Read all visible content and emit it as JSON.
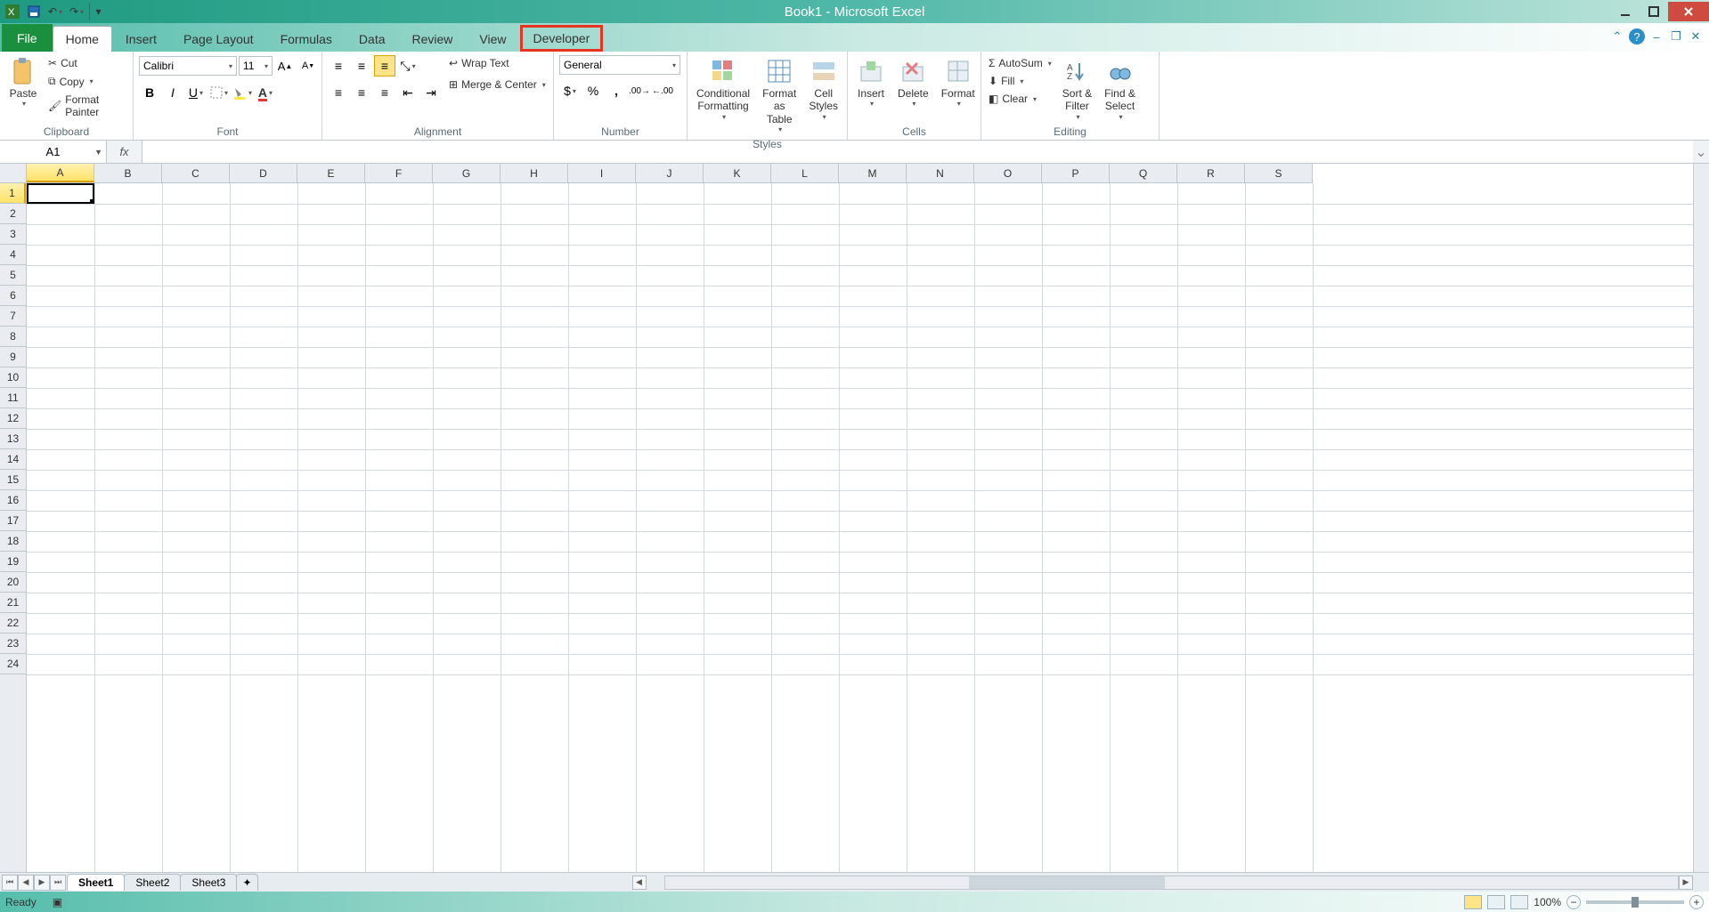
{
  "title": "Book1 - Microsoft Excel",
  "tabs": {
    "file": "File",
    "home": "Home",
    "insert": "Insert",
    "pageLayout": "Page Layout",
    "formulas": "Formulas",
    "data": "Data",
    "review": "Review",
    "view": "View",
    "developer": "Developer"
  },
  "ribbon": {
    "clipboard": {
      "label": "Clipboard",
      "paste": "Paste",
      "cut": "Cut",
      "copy": "Copy",
      "formatPainter": "Format Painter"
    },
    "font": {
      "label": "Font",
      "name": "Calibri",
      "size": "11"
    },
    "alignment": {
      "label": "Alignment",
      "wrapText": "Wrap Text",
      "mergeCenter": "Merge & Center"
    },
    "number": {
      "label": "Number",
      "format": "General"
    },
    "styles": {
      "label": "Styles",
      "conditional": "Conditional\nFormatting",
      "asTable": "Format\nas Table",
      "cellStyles": "Cell\nStyles"
    },
    "cells": {
      "label": "Cells",
      "insert": "Insert",
      "delete": "Delete",
      "format": "Format"
    },
    "editing": {
      "label": "Editing",
      "autoSum": "AutoSum",
      "fill": "Fill",
      "clear": "Clear",
      "sortFilter": "Sort &\nFilter",
      "findSelect": "Find &\nSelect"
    }
  },
  "nameBox": "A1",
  "formula": "",
  "columns": [
    "A",
    "B",
    "C",
    "D",
    "E",
    "F",
    "G",
    "H",
    "I",
    "J",
    "K",
    "L",
    "M",
    "N",
    "O",
    "P",
    "Q",
    "R",
    "S"
  ],
  "rows": [
    "1",
    "2",
    "3",
    "4",
    "5",
    "6",
    "7",
    "8",
    "9",
    "10",
    "11",
    "12",
    "13",
    "14",
    "15",
    "16",
    "17",
    "18",
    "19",
    "20",
    "21",
    "22",
    "23",
    "24"
  ],
  "sheets": {
    "s1": "Sheet1",
    "s2": "Sheet2",
    "s3": "Sheet3"
  },
  "status": {
    "ready": "Ready",
    "zoom": "100%"
  }
}
